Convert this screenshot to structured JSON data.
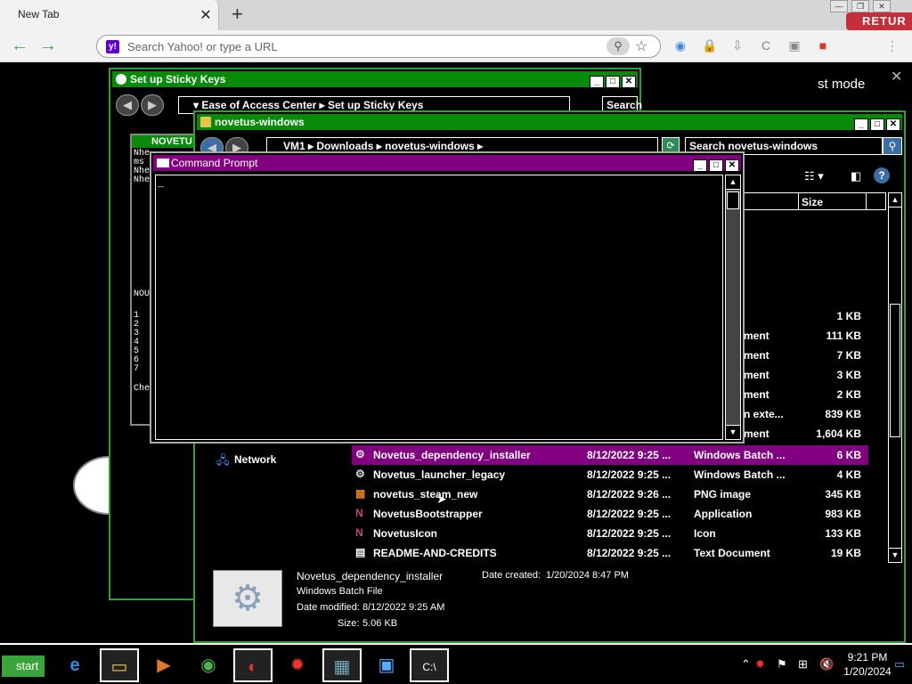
{
  "browser": {
    "tab_title": "New Tab",
    "tab_close": "✕",
    "new_tab": "+",
    "omnibox_placeholder": "Search Yahoo! or type a URL",
    "yahoo_badge": "y!",
    "back": "←",
    "forward": "→",
    "retu_badge": "RETUR",
    "zoom_glyph": "⚲",
    "star_glyph": "☆"
  },
  "page": {
    "mode_text": "st mode",
    "close_glyph": "✕"
  },
  "sticky_keys": {
    "title": "Set up Sticky Keys",
    "breadcrumb": "▾  Ease of Access Center  ▸  Set up Sticky Keys",
    "search_placeholder": "Search Control Panel",
    "inner_title": "NOVETU",
    "inner_lines": [
      "Nhe",
      "ms",
      "Nhe",
      "Nhe"
    ],
    "inner_menu_title": "NOU",
    "inner_menu_items": [
      "1",
      "2",
      "3",
      "4",
      "5",
      "6",
      "7"
    ],
    "inner_footer": "Che"
  },
  "explorer": {
    "title": "novetus-windows",
    "breadcrumb_parts": [
      "VM1",
      "Downloads",
      "novetus-windows"
    ],
    "search_placeholder": "Search novetus-windows",
    "col_size": "Size",
    "nav_network": "Network",
    "partial_rows": [
      {
        "type": "",
        "size": "1 KB"
      },
      {
        "type": "ment",
        "size": "111 KB"
      },
      {
        "type": "ment",
        "size": "7 KB"
      },
      {
        "type": "ment",
        "size": "3 KB"
      },
      {
        "type": "ment",
        "size": "2 KB"
      },
      {
        "type": "n exte...",
        "size": "839 KB"
      },
      {
        "type": "ment",
        "size": "1,604 KB"
      }
    ],
    "rows": [
      {
        "name": "Novetus_dependency_installer",
        "date": "8/12/2022 9:25 ...",
        "type": "Windows Batch ...",
        "size": "6 KB",
        "selected": true
      },
      {
        "name": "Novetus_launcher_legacy",
        "date": "8/12/2022 9:25 ...",
        "type": "Windows Batch ...",
        "size": "4 KB",
        "selected": false
      },
      {
        "name": "novetus_steam_new",
        "date": "8/12/2022 9:26 ...",
        "type": "PNG image",
        "size": "345 KB",
        "selected": false
      },
      {
        "name": "NovetusBootstrapper",
        "date": "8/12/2022 9:25 ...",
        "type": "Application",
        "size": "983 KB",
        "selected": false
      },
      {
        "name": "NovetusIcon",
        "date": "8/12/2022 9:25 ...",
        "type": "Icon",
        "size": "133 KB",
        "selected": false
      },
      {
        "name": "README-AND-CREDITS",
        "date": "8/12/2022 9:25 ...",
        "type": "Text Document",
        "size": "19 KB",
        "selected": false
      }
    ],
    "details": {
      "name": "Novetus_dependency_installer",
      "kind": "Windows Batch File",
      "date_modified_label": "Date modified:",
      "date_modified": "8/12/2022 9:25 AM",
      "size_label": "Size:",
      "size": "5.06 KB",
      "date_created_label": "Date created:",
      "date_created": "1/20/2024 8:47 PM"
    }
  },
  "cmd": {
    "title": "Command Prompt",
    "cursor": "_"
  },
  "taskbar": {
    "start_label": "start",
    "time": "9:21 PM",
    "date": "1/20/2024"
  }
}
